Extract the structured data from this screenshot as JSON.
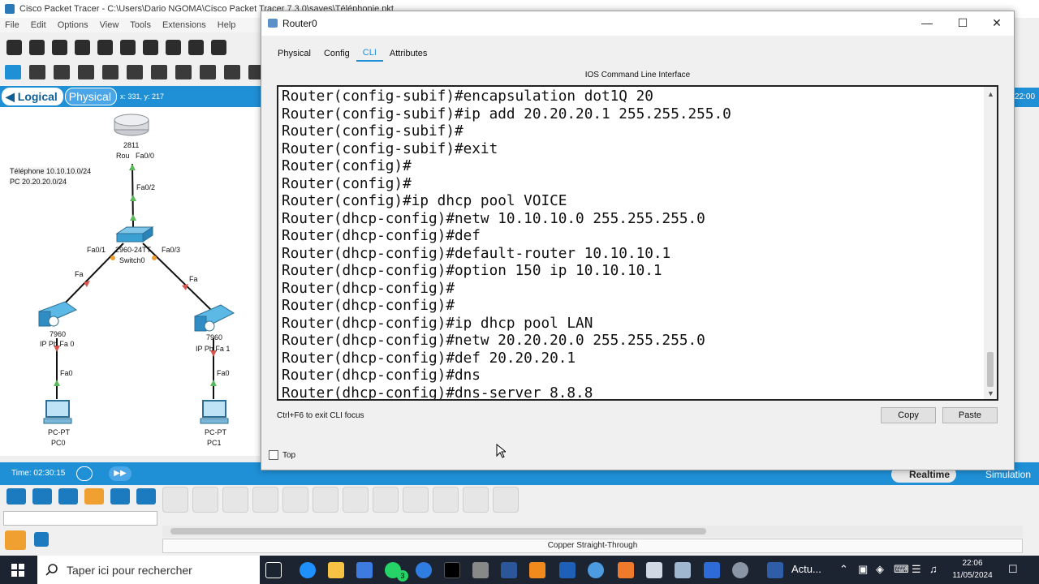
{
  "app": {
    "title": "Cisco Packet Tracer - C:\\Users\\Dario NGOMA\\Cisco Packet Tracer 7.3.0\\saves\\Téléphonie.pkt",
    "menu": [
      "File",
      "Edit",
      "Options",
      "View",
      "Tools",
      "Extensions",
      "Help"
    ]
  },
  "workspace": {
    "mode_logical": "Logical",
    "mode_physical": "Physical",
    "coords": "x: 331, y: 217",
    "note_line1": "Téléphone 10.10.10.0/24",
    "note_line2": "PC 20.20.20.0/24",
    "router_model": "2811",
    "router_name": "Rou",
    "router_port": "Fa0/0",
    "switch_uplink": "Fa0/2",
    "switch_model": "2960-24TT",
    "switch_name": "Switch0",
    "switch_port_left": "Fa0/1",
    "switch_port_right": "Fa0/3",
    "phone_left_fa": "Fa",
    "phone_right_fa": "Fa",
    "phone_model": "7960",
    "phone_left_label": "IP Ph Fa 0",
    "phone_right_label": "IP Ph Fa 1",
    "phone_left_down": "Fa0",
    "phone_right_down": "Fa0",
    "pc_type": "PC-PT",
    "pc_left": "PC0",
    "pc_right": "PC1",
    "time": "Time: 02:30:15",
    "realtime": "Realtime",
    "simulation": "Simulation",
    "right_clock": "22:00",
    "cable_caption": "Copper Straight-Through"
  },
  "dialog": {
    "title": "Router0",
    "tabs": [
      "Physical",
      "Config",
      "CLI",
      "Attributes"
    ],
    "active_tab": "CLI",
    "heading": "IOS Command Line Interface",
    "cli_lines": [
      "Router(config-subif)#encapsulation dot1Q 20",
      "Router(config-subif)#ip add 20.20.20.1 255.255.255.0",
      "Router(config-subif)#",
      "Router(config-subif)#exit",
      "Router(config)#",
      "Router(config)#",
      "Router(config)#ip dhcp pool VOICE",
      "Router(dhcp-config)#netw 10.10.10.0 255.255.255.0",
      "Router(dhcp-config)#def",
      "Router(dhcp-config)#default-router 10.10.10.1",
      "Router(dhcp-config)#option 150 ip 10.10.10.1",
      "Router(dhcp-config)#",
      "Router(dhcp-config)#",
      "Router(dhcp-config)#ip dhcp pool LAN",
      "Router(dhcp-config)#netw 20.20.20.0 255.255.255.0",
      "Router(dhcp-config)#def 20.20.20.1",
      "Router(dhcp-config)#dns",
      "Router(dhcp-config)#dns-server 8.8.8"
    ],
    "hint": "Ctrl+F6 to exit CLI focus",
    "copy_label": "Copy",
    "paste_label": "Paste",
    "top_label": "Top"
  },
  "taskbar": {
    "search_placeholder": "Taper ici pour rechercher",
    "whatsapp_badge": "3",
    "news": "Actu...",
    "time": "22:06",
    "date": "11/05/2024"
  },
  "colors": {
    "accent": "#1f8fd6",
    "taskbar": "#1c2331",
    "cable_green": "#5cb85c",
    "port_red": "#d9534f"
  }
}
